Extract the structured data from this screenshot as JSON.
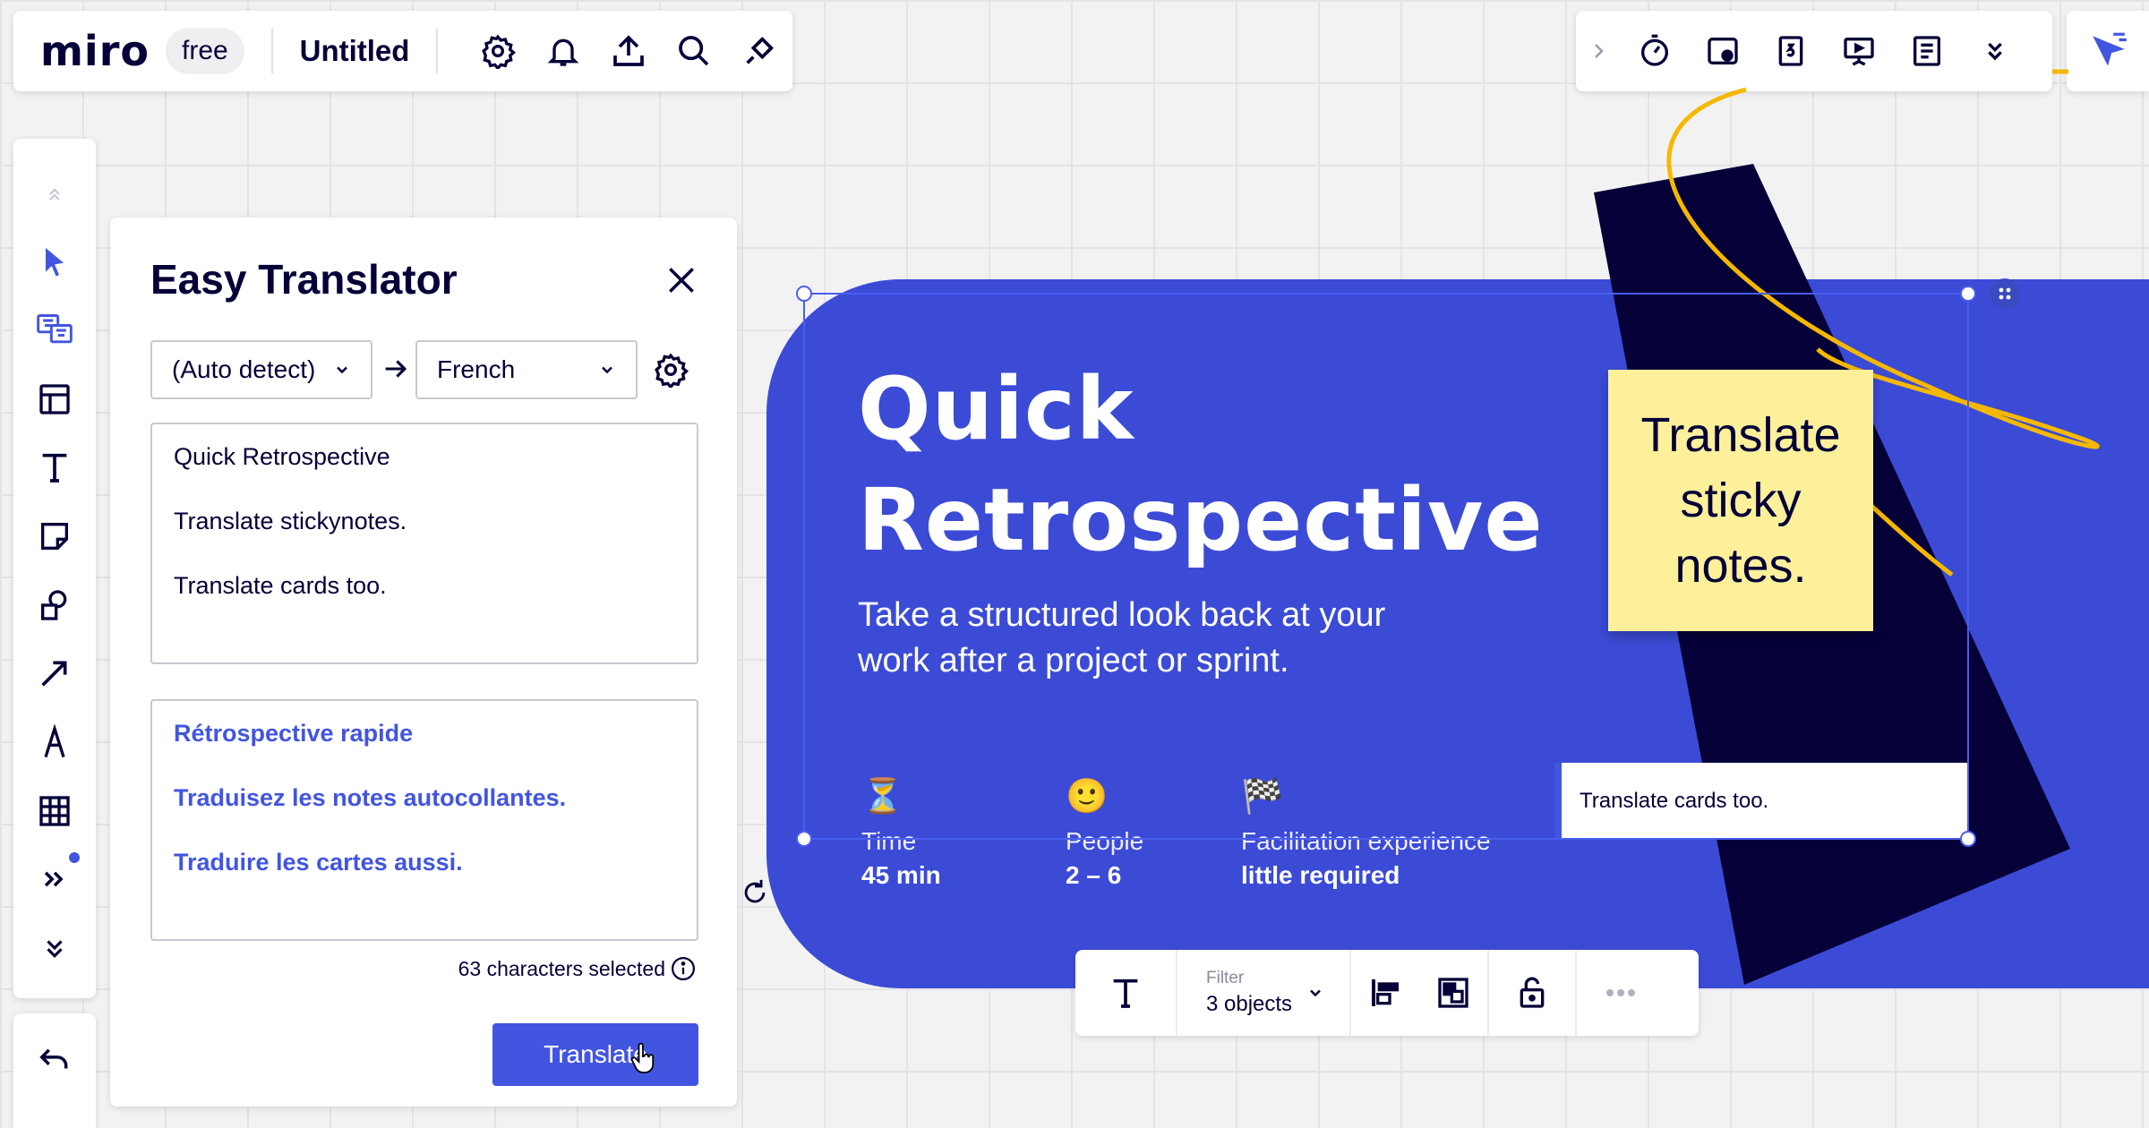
{
  "topbar": {
    "logo": "miro",
    "plan_badge": "free",
    "board_title": "Untitled"
  },
  "translator": {
    "title": "Easy Translator",
    "source_language": "(Auto detect)",
    "target_language": "French",
    "input_lines": [
      "Quick Retrospective",
      "Translate stickynotes.",
      "Translate cards too."
    ],
    "output_lines": [
      "Rétrospective rapide",
      "Traduisez les notes autocollantes.",
      "Traduire les cartes aussi."
    ],
    "char_count": "63 characters selected",
    "translate_button": "Translate"
  },
  "board": {
    "heading_line1": "Quick",
    "heading_line2": "Retrospective",
    "subtitle": "Take a structured look back at your work after a project or sprint.",
    "meta": [
      {
        "emoji": "⏳",
        "label": "Time",
        "value": "45 min"
      },
      {
        "emoji": "🙂",
        "label": "People",
        "value": "2 – 6"
      },
      {
        "emoji": "🏁",
        "label": "Facilitation experience",
        "value": "little required"
      }
    ],
    "sticky_note": "Translate sticky notes.",
    "card_text": "Translate cards too."
  },
  "context_toolbar": {
    "filter_label": "Filter",
    "filter_value": "3 objects"
  },
  "colors": {
    "accent": "#4255e0",
    "card": "#3b4bd6",
    "dark_shape": "#050038",
    "sticky": "#fdf09a",
    "curve": "#fcb800"
  },
  "icons": [
    "settings-icon",
    "bell-icon",
    "upload-icon",
    "search-icon",
    "plugin-icon",
    "chevron-right-icon",
    "timer-icon",
    "vote-icon",
    "countdown-icon",
    "presentation-icon",
    "notes-icon",
    "double-chevron-down-icon",
    "collaborate-cursor-icon",
    "cursor-icon",
    "translator-app-icon",
    "templates-icon",
    "text-icon",
    "sticky-icon",
    "shapes-icon",
    "arrow-icon",
    "pen-icon",
    "table-icon",
    "more-tools-icon",
    "undo-icon",
    "close-icon",
    "info-icon",
    "lock-icon",
    "more-icon"
  ]
}
